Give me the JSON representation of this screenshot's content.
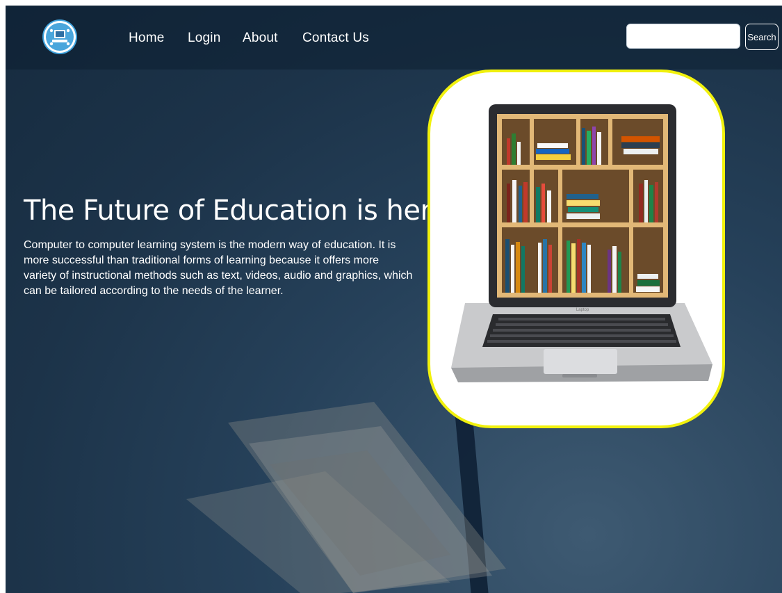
{
  "nav": {
    "logo_icon": "education-logo-icon",
    "links": [
      "Home",
      "Login",
      "About",
      "Contact Us"
    ]
  },
  "search": {
    "placeholder": "",
    "value": "",
    "button_label": "Search"
  },
  "hero": {
    "title": "The Future of Education is here",
    "description": "Computer to computer learning system is the modern way of education. It is more successful than traditional forms of learning because it offers more variety of instructional methods such as text, videos, audio and graphics, which can be tailored according to the needs of the learner.",
    "image_icon": "laptop-bookshelf-image"
  },
  "colors": {
    "background": "#1c3349",
    "image_border": "#f1f10d",
    "text": "#ffffff"
  }
}
